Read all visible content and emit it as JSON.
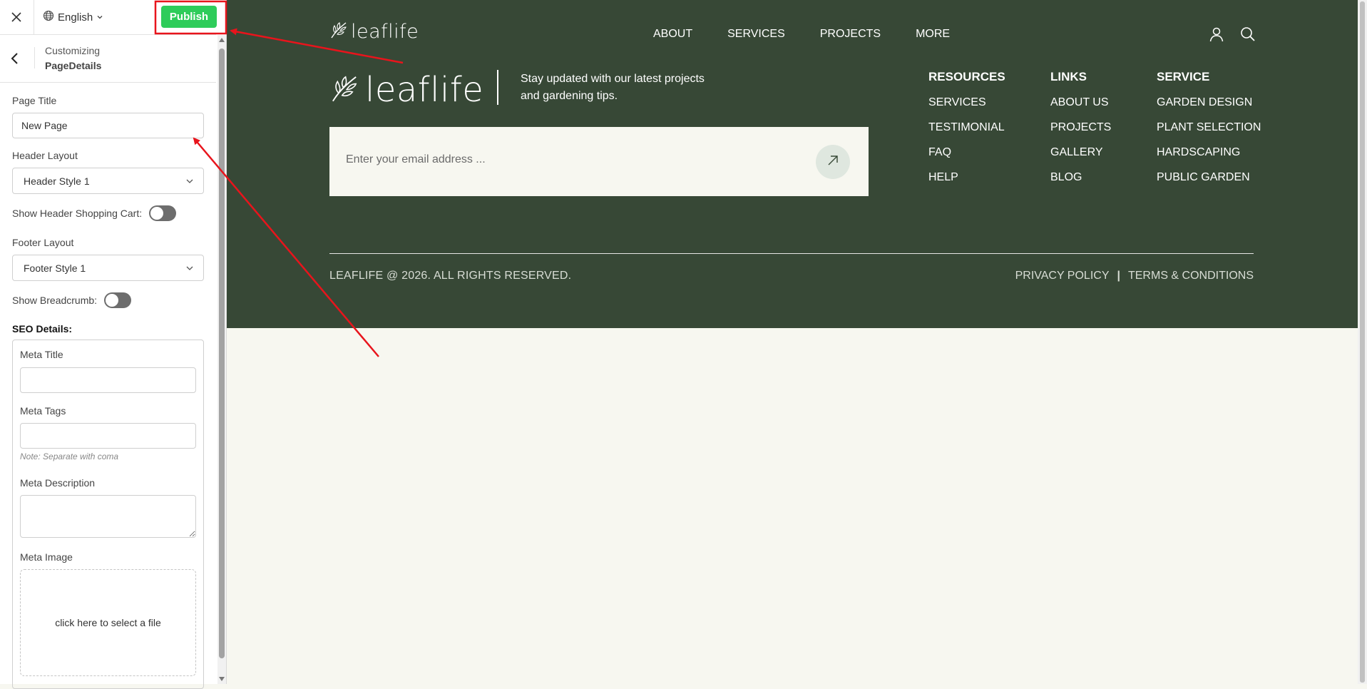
{
  "customizer": {
    "language": "English",
    "publish_label": "Publish",
    "breadcrumb": "Customizing",
    "section_title": "PageDetails",
    "fields": {
      "page_title_label": "Page Title",
      "page_title_value": "New Page",
      "header_layout_label": "Header Layout",
      "header_layout_value": "Header Style 1",
      "show_cart_label": "Show Header Shopping Cart:",
      "footer_layout_label": "Footer Layout",
      "footer_layout_value": "Footer Style 1",
      "show_breadcrumb_label": "Show Breadcrumb:"
    },
    "seo": {
      "heading": "SEO Details:",
      "meta_title_label": "Meta Title",
      "meta_tags_label": "Meta Tags",
      "meta_tags_note": "Note: Separate with coma",
      "meta_description_label": "Meta Description",
      "meta_image_label": "Meta Image",
      "file_prompt": "click here to select a file"
    },
    "toggles": {
      "show_cart": false,
      "show_breadcrumb": false
    }
  },
  "site": {
    "logo": "leaflife",
    "nav": [
      "ABOUT",
      "SERVICES",
      "PROJECTS",
      "MORE"
    ],
    "tagline": "Stay updated with our latest projects and gardening tips.",
    "newsletter_placeholder": "Enter your email address ...",
    "columns": [
      {
        "heading": "RESOURCES",
        "links": [
          "SERVICES",
          "TESTIMONIAL",
          "FAQ",
          "HELP"
        ]
      },
      {
        "heading": "LINKS",
        "links": [
          "ABOUT US",
          "PROJECTS",
          "GALLERY",
          "BLOG"
        ]
      },
      {
        "heading": "SERVICE",
        "links": [
          "GARDEN DESIGN",
          "PLANT SELECTION",
          "HARDSCAPING",
          "PUBLIC GARDEN"
        ]
      }
    ],
    "copyright": "LEAFLIFE @ 2026. ALL RIGHTS RESERVED.",
    "legal": {
      "privacy": "PRIVACY POLICY",
      "separator": "|",
      "terms": "TERMS & CONDITIONS"
    }
  },
  "colors": {
    "footer_bg": "#374836",
    "page_bg": "#f7f7f0",
    "publish_green": "#2ecc5a",
    "annotation_red": "#e8141c"
  }
}
